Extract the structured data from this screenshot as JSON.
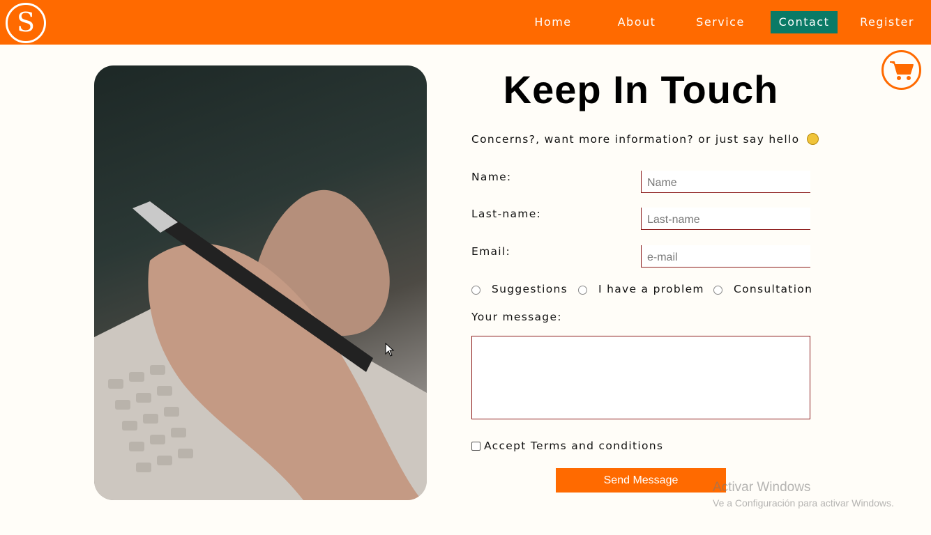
{
  "header": {
    "logo_letter": "S",
    "nav": [
      {
        "label": "Home"
      },
      {
        "label": "About"
      },
      {
        "label": "Service"
      },
      {
        "label": "Contact",
        "active": true
      },
      {
        "label": "Register"
      }
    ]
  },
  "colors": {
    "brand": "#ff6a00",
    "active_nav": "#0a7a66",
    "input_border": "#8b1a1a"
  },
  "cart": {
    "icon": "shopping-cart-icon"
  },
  "hero_image": {
    "description_icon": "phone-photo"
  },
  "form": {
    "title": "Keep In Touch",
    "subtitle": "Concerns?, want more information? or just say hello",
    "emoji_icon": "smiley-emoji-icon",
    "fields": {
      "name": {
        "label": "Name:",
        "placeholder": "Name"
      },
      "last_name": {
        "label": "Last-name:",
        "placeholder": "Last-name"
      },
      "email": {
        "label": "Email:",
        "placeholder": "e-mail"
      }
    },
    "options": [
      {
        "label": "Suggestions"
      },
      {
        "label": "I have a problem"
      },
      {
        "label": "Consultation"
      }
    ],
    "message_label": "Your message:",
    "message_value": "",
    "terms_label": "Accept Terms and conditions",
    "submit_label": "Send Message"
  },
  "watermark": {
    "line1": "Activar Windows",
    "line2": "Ve a Configuración para activar Windows."
  }
}
